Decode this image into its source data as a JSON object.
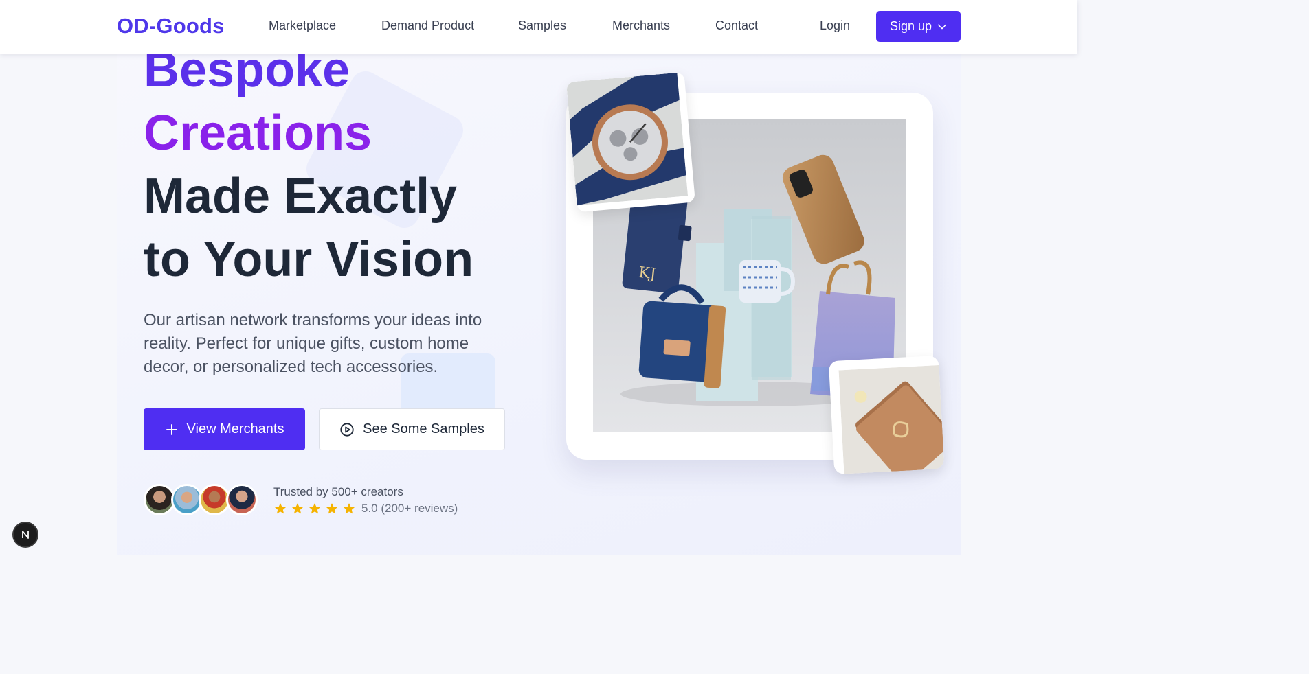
{
  "brand": {
    "name": "OD-Goods",
    "accent": "#4f2ef2",
    "purple": "#8a22ea"
  },
  "nav": {
    "items": [
      {
        "label": "Marketplace"
      },
      {
        "label": "Demand Product"
      },
      {
        "label": "Samples"
      },
      {
        "label": "Merchants"
      },
      {
        "label": "Contact"
      }
    ],
    "login": "Login",
    "signup": "Sign up"
  },
  "hero": {
    "headline": [
      "Bespoke",
      "Creations",
      "Made Exactly",
      "to Your Vision"
    ],
    "subtext": "Our artisan network transforms your ideas into reality. Perfect for unique gifts, custom home decor, or personalized tech accessories.",
    "primary_button": "View Merchants",
    "secondary_button": "See Some Samples"
  },
  "trust": {
    "text": "Trusted by 500+ creators",
    "rating": "5.0 (200+ reviews)",
    "stars": 5,
    "avatars": [
      "avatar-1",
      "avatar-2",
      "avatar-3",
      "avatar-4"
    ]
  },
  "icons": {
    "signup": "chevron-down-icon",
    "primary": "plus-icon",
    "secondary": "play-circle-icon",
    "star": "star-icon",
    "badge": "next-logo-icon"
  },
  "showcase": {
    "products": [
      "watch",
      "wallet",
      "backpack",
      "mug",
      "phone-case",
      "tote-bag",
      "notebook"
    ],
    "monogram": "KJ"
  }
}
